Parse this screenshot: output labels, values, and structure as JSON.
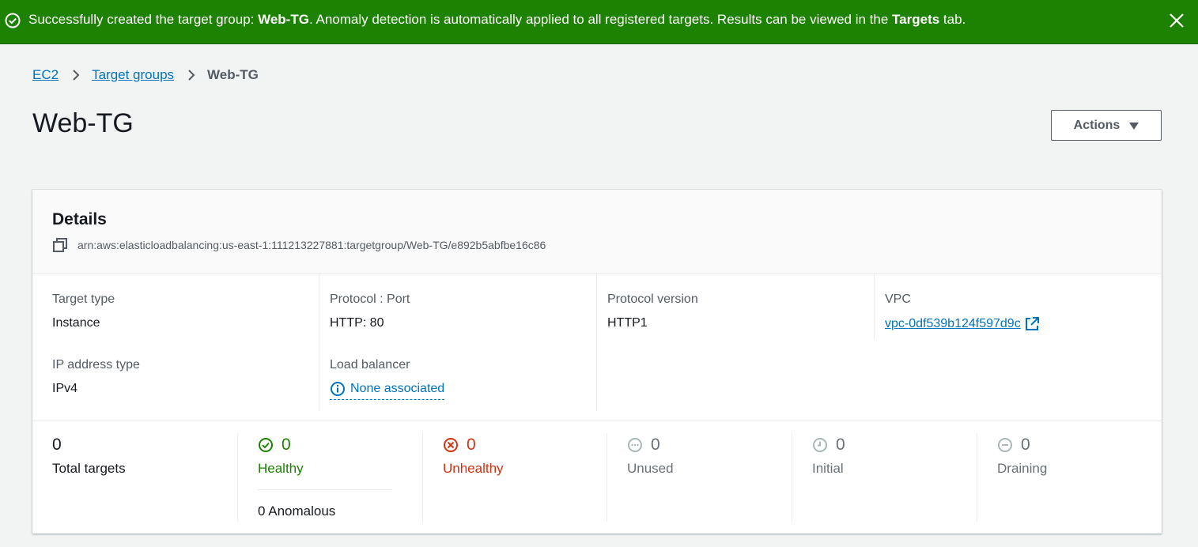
{
  "flash": {
    "prefix": "Successfully created the target group: ",
    "name": "Web-TG",
    "middle": ". Anomaly detection is automatically applied to all registered targets. Results can be viewed in the ",
    "tab": "Targets",
    "suffix": " tab.",
    "color": "#1d8102"
  },
  "breadcrumb": {
    "items": [
      "EC2",
      "Target groups"
    ],
    "current": "Web-TG"
  },
  "page": {
    "title": "Web-TG",
    "actions_label": "Actions"
  },
  "details": {
    "heading": "Details",
    "arn": "arn:aws:elasticloadbalancing:us-east-1:111213227881:targetgroup/Web-TG/e892b5abfbe16c86",
    "target_type": {
      "label": "Target type",
      "value": "Instance"
    },
    "ip_address_type": {
      "label": "IP address type",
      "value": "IPv4"
    },
    "protocol_port": {
      "label": "Protocol : Port",
      "value": "HTTP: 80"
    },
    "load_balancer": {
      "label": "Load balancer",
      "value": "None associated"
    },
    "protocol_version": {
      "label": "Protocol version",
      "value": "HTTP1"
    },
    "vpc": {
      "label": "VPC",
      "value": "vpc-0df539b124f597d9c"
    }
  },
  "stats": {
    "total": {
      "value": "0",
      "label": "Total targets"
    },
    "healthy": {
      "value": "0",
      "label": "Healthy",
      "anomalous": "0 Anomalous"
    },
    "unhealthy": {
      "value": "0",
      "label": "Unhealthy"
    },
    "unused": {
      "value": "0",
      "label": "Unused"
    },
    "initial": {
      "value": "0",
      "label": "Initial"
    },
    "draining": {
      "value": "0",
      "label": "Draining"
    }
  },
  "colors": {
    "link": "#0073bb",
    "healthy": "#1d8102",
    "unhealthy": "#d13212",
    "neutral": "#687078"
  }
}
